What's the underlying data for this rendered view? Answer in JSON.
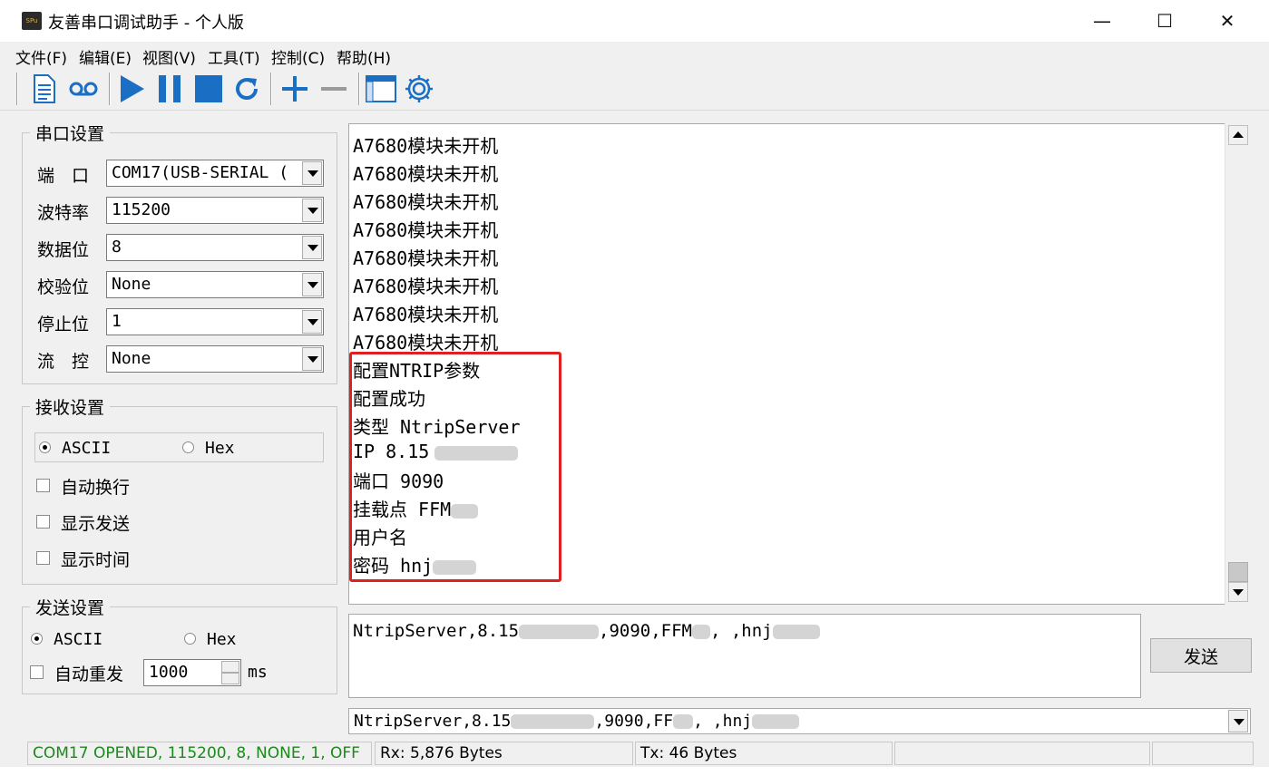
{
  "window": {
    "icon_text": "SPu",
    "title": "友善串口调试助手 - 个人版",
    "min": "—",
    "max": "☐",
    "close": "✕"
  },
  "menu": [
    "文件(F)",
    "编辑(E)",
    "视图(V)",
    "工具(T)",
    "控制(C)",
    "帮助(H)"
  ],
  "toolbar": {
    "icons": [
      "document-icon",
      "tape-icon",
      "play-icon",
      "pause-icon",
      "stop-icon",
      "refresh-icon",
      "plus-icon",
      "minus-icon",
      "window-icon",
      "gear-icon"
    ],
    "accent": "#1a6fc4"
  },
  "serial_settings": {
    "title": "串口设置",
    "port_label": "端　口",
    "port_value": "COM17(USB-SERIAL (",
    "baud_label": "波特率",
    "baud_value": "115200",
    "databits_label": "数据位",
    "databits_value": "8",
    "parity_label": "校验位",
    "parity_value": "None",
    "stopbits_label": "停止位",
    "stopbits_value": "1",
    "flow_label": "流　控",
    "flow_value": "None"
  },
  "receive_settings": {
    "title": "接收设置",
    "ascii_label": "ASCII",
    "hex_label": "Hex",
    "selected": "ASCII",
    "auto_wrap_label": "自动换行",
    "show_send_label": "显示发送",
    "show_time_label": "显示时间"
  },
  "send_settings": {
    "title": "发送设置",
    "ascii_label": "ASCII",
    "hex_label": "Hex",
    "selected": "ASCII",
    "auto_resend_label": "自动重发",
    "interval_value": "1000",
    "interval_unit": "ms"
  },
  "receive_lines": [
    "A7680模块未开机",
    "A7680模块未开机",
    "A7680模块未开机",
    "A7680模块未开机",
    "A7680模块未开机",
    "A7680模块未开机",
    "A7680模块未开机",
    "A7680模块未开机",
    "配置NTRIP参数",
    "配置成功",
    "类型 NtripServer",
    "IP 8.15",
    "端口 9090",
    "挂载点 FFM",
    "用户名",
    "密码 hnj"
  ],
  "send_text": {
    "part1": "NtripServer,8.15",
    "part2": ",9090,FFM",
    "part3": ", ,hnj"
  },
  "send_button": "发送",
  "history": {
    "part1": "NtripServer,8.15",
    "part2": ",9090,FF",
    "part3": ", ,hnj"
  },
  "status": {
    "port_state": "COM17 OPENED, 115200, 8, NONE, 1, OFF",
    "port_state_color": "#1a8a1a",
    "rx": "Rx: 5,876 Bytes",
    "tx": "Tx: 46 Bytes"
  }
}
